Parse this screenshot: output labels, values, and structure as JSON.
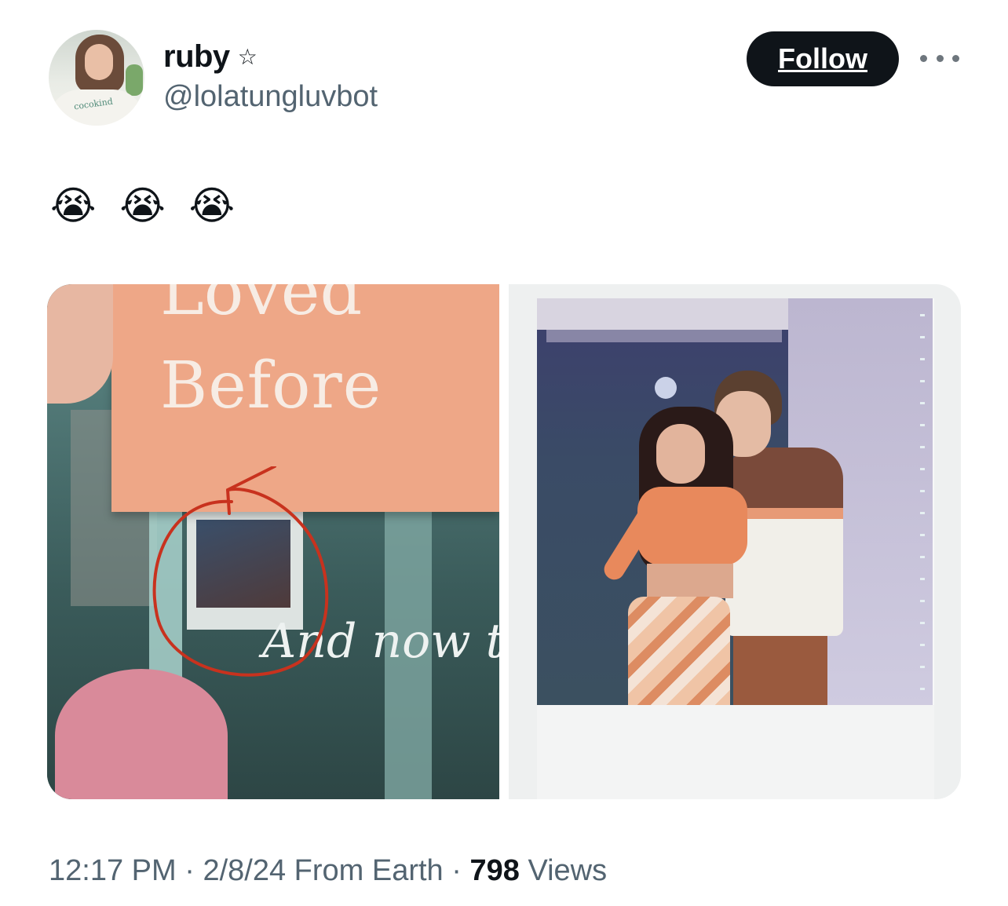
{
  "user": {
    "display_name": "ruby",
    "badge_icon": "star-icon",
    "badge_glyph": "☆",
    "handle": "@lolatungluvbot",
    "avatar_shirt_text": "cocokind"
  },
  "actions": {
    "follow_label": "Follow",
    "more_icon": "more-horizontal-icon"
  },
  "tweet": {
    "text": "😭 😭 😭"
  },
  "media": {
    "left_photo": {
      "book_partial_title": "Loved",
      "book_title_line": "Before",
      "page_text": "And now t",
      "annotation_color": "#c8321e"
    },
    "right_photo": {
      "description_icon": "polaroid-photo"
    }
  },
  "meta": {
    "time": "12:17 PM",
    "sep1": " · ",
    "date": "2/8/24",
    "location": " From Earth",
    "sep2": " · ",
    "views_count": "798",
    "views_label": " Views"
  },
  "colors": {
    "text_primary": "#0f1419",
    "text_secondary": "#536471",
    "button_bg": "#0f1419",
    "button_text": "#ffffff"
  }
}
